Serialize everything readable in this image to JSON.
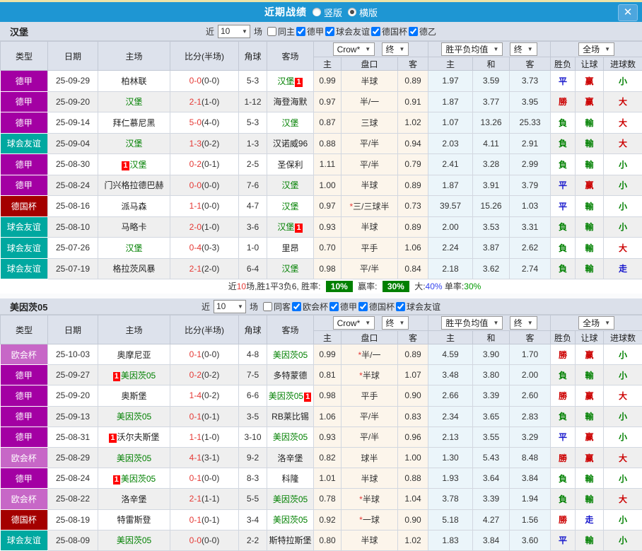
{
  "titlebar": {
    "title": "近期战绩",
    "radio_vertical": "竖版",
    "radio_horizontal": "横版",
    "close_glyph": "✕"
  },
  "colors": {
    "titlebar_bg": "#1E96D3",
    "top_strip": "#EDE3A8",
    "team_highlight": "#008000",
    "badge_red": "#FF0000",
    "score_red": "#E53935",
    "summary_badge_bg": "#008000",
    "type": {
      "德甲": "#A300A3",
      "球会友谊": "#00A8A0",
      "德国杯": "#A40000",
      "欧会杯": "#C767C7"
    },
    "result": {
      "勝": "#CC0000",
      "赢": "#CC0000",
      "大": "#CC0000",
      "負": "#008000",
      "輸": "#008000",
      "小": "#008000",
      "平": "#1515CC",
      "走": "#1515CC"
    }
  },
  "table_header": {
    "main_cols": [
      "类型",
      "日期",
      "主场",
      "比分(半场)",
      "角球",
      "客场"
    ],
    "sub_cols": [
      "主",
      "盘口",
      "客",
      "主",
      "和",
      "客",
      "胜负",
      "让球",
      "进球数"
    ],
    "dropdowns": {
      "bookmaker": "Crow*",
      "final1": "终",
      "avg": "胜平负均值",
      "final2": "终",
      "scope": "全场"
    }
  },
  "sections": [
    {
      "team": "汉堡",
      "filters": {
        "near_label": "近",
        "count": "10",
        "games_label": "场",
        "same_label": "同主",
        "same_checked": false,
        "leagues": [
          {
            "label": "德甲",
            "checked": true
          },
          {
            "label": "球会友谊",
            "checked": true
          },
          {
            "label": "德国杯",
            "checked": true
          },
          {
            "label": "德乙",
            "checked": true
          }
        ]
      },
      "rows": [
        {
          "type": "德甲",
          "date": "25-09-29",
          "home": "柏林联",
          "home_green": false,
          "home_badge": "",
          "score": "0-0",
          "half": "(0-0)",
          "corner": "5-3",
          "away": "汉堡",
          "away_green": true,
          "away_badge": "1",
          "odds": [
            "0.99",
            "半球",
            "0.89"
          ],
          "avg": [
            "1.97",
            "3.59",
            "3.73"
          ],
          "res": [
            "平",
            "赢",
            "小"
          ]
        },
        {
          "type": "德甲",
          "date": "25-09-20",
          "home": "汉堡",
          "home_green": true,
          "home_badge": "",
          "score": "2-1",
          "half": "(1-0)",
          "corner": "1-12",
          "away": "海登海默",
          "away_green": false,
          "away_badge": "",
          "odds": [
            "0.97",
            "半/一",
            "0.91"
          ],
          "avg": [
            "1.87",
            "3.77",
            "3.95"
          ],
          "res": [
            "勝",
            "赢",
            "大"
          ]
        },
        {
          "type": "德甲",
          "date": "25-09-14",
          "home": "拜仁慕尼黑",
          "home_green": false,
          "home_badge": "",
          "score": "5-0",
          "half": "(4-0)",
          "corner": "5-3",
          "away": "汉堡",
          "away_green": true,
          "away_badge": "",
          "odds": [
            "0.87",
            "三球",
            "1.02"
          ],
          "avg": [
            "1.07",
            "13.26",
            "25.33"
          ],
          "res": [
            "負",
            "輸",
            "大"
          ]
        },
        {
          "type": "球会友谊",
          "date": "25-09-04",
          "home": "汉堡",
          "home_green": true,
          "home_badge": "",
          "score": "1-3",
          "half": "(0-2)",
          "corner": "1-3",
          "away": "汉诺威96",
          "away_green": false,
          "away_badge": "",
          "odds": [
            "0.88",
            "平/半",
            "0.94"
          ],
          "avg": [
            "2.03",
            "4.11",
            "2.91"
          ],
          "res": [
            "負",
            "輸",
            "大"
          ]
        },
        {
          "type": "德甲",
          "date": "25-08-30",
          "home": "汉堡",
          "home_green": true,
          "home_badge": "1",
          "score": "0-2",
          "half": "(0-1)",
          "corner": "2-5",
          "away": "圣保利",
          "away_green": false,
          "away_badge": "",
          "odds": [
            "1.11",
            "平/半",
            "0.79"
          ],
          "avg": [
            "2.41",
            "3.28",
            "2.99"
          ],
          "res": [
            "負",
            "輸",
            "小"
          ]
        },
        {
          "type": "德甲",
          "date": "25-08-24",
          "home": "门兴格拉德巴赫",
          "home_green": false,
          "home_badge": "",
          "score": "0-0",
          "half": "(0-0)",
          "corner": "7-6",
          "away": "汉堡",
          "away_green": true,
          "away_badge": "",
          "odds": [
            "1.00",
            "半球",
            "0.89"
          ],
          "avg": [
            "1.87",
            "3.91",
            "3.79"
          ],
          "res": [
            "平",
            "赢",
            "小"
          ]
        },
        {
          "type": "德国杯",
          "date": "25-08-16",
          "home": "派马森",
          "home_green": false,
          "home_badge": "",
          "score": "1-1",
          "half": "(0-0)",
          "corner": "4-7",
          "away": "汉堡",
          "away_green": true,
          "away_badge": "",
          "odds": [
            "0.97",
            "*三/三球半",
            "0.73"
          ],
          "avg": [
            "39.57",
            "15.26",
            "1.03"
          ],
          "res": [
            "平",
            "輸",
            "小"
          ]
        },
        {
          "type": "球会友谊",
          "date": "25-08-10",
          "home": "马略卡",
          "home_green": false,
          "home_badge": "",
          "score": "2-0",
          "half": "(1-0)",
          "corner": "3-6",
          "away": "汉堡",
          "away_green": true,
          "away_badge": "1",
          "odds": [
            "0.93",
            "半球",
            "0.89"
          ],
          "avg": [
            "2.00",
            "3.53",
            "3.31"
          ],
          "res": [
            "負",
            "輸",
            "小"
          ]
        },
        {
          "type": "球会友谊",
          "date": "25-07-26",
          "home": "汉堡",
          "home_green": true,
          "home_badge": "",
          "score": "0-4",
          "half": "(0-3)",
          "corner": "1-0",
          "away": "里昂",
          "away_green": false,
          "away_badge": "",
          "odds": [
            "0.70",
            "平手",
            "1.06"
          ],
          "avg": [
            "2.24",
            "3.87",
            "2.62"
          ],
          "res": [
            "負",
            "輸",
            "大"
          ]
        },
        {
          "type": "球会友谊",
          "date": "25-07-19",
          "home": "格拉茨风暴",
          "home_green": false,
          "home_badge": "",
          "score": "2-1",
          "half": "(2-0)",
          "corner": "6-4",
          "away": "汉堡",
          "away_green": true,
          "away_badge": "",
          "odds": [
            "0.98",
            "平/半",
            "0.84"
          ],
          "avg": [
            "2.18",
            "3.62",
            "2.74"
          ],
          "res": [
            "負",
            "輸",
            "走"
          ]
        }
      ],
      "summary": {
        "pre": "近",
        "num": "10",
        "post": "场,胜1平3负6, 胜率:",
        "rate1": "10%",
        "label2": "赢率:",
        "rate2": "30%",
        "label3": "大:",
        "rate3": "40%",
        "label4": "单率:",
        "rate4": "30%"
      }
    },
    {
      "team": "美因茨05",
      "filters": {
        "near_label": "近",
        "count": "10",
        "games_label": "场",
        "same_label": "同客",
        "same_checked": false,
        "leagues": [
          {
            "label": "欧会杯",
            "checked": true
          },
          {
            "label": "德甲",
            "checked": true
          },
          {
            "label": "德国杯",
            "checked": true
          },
          {
            "label": "球会友谊",
            "checked": true
          }
        ]
      },
      "rows": [
        {
          "type": "欧会杯",
          "date": "25-10-03",
          "home": "奥摩尼亚",
          "home_green": false,
          "home_badge": "",
          "score": "0-1",
          "half": "(0-0)",
          "corner": "4-8",
          "away": "美因茨05",
          "away_green": true,
          "away_badge": "",
          "odds": [
            "0.99",
            "*半/一",
            "0.89"
          ],
          "avg": [
            "4.59",
            "3.90",
            "1.70"
          ],
          "res": [
            "勝",
            "赢",
            "小"
          ]
        },
        {
          "type": "德甲",
          "date": "25-09-27",
          "home": "美因茨05",
          "home_green": true,
          "home_badge": "1",
          "score": "0-2",
          "half": "(0-2)",
          "corner": "7-5",
          "away": "多特蒙德",
          "away_green": false,
          "away_badge": "",
          "odds": [
            "0.81",
            "*半球",
            "1.07"
          ],
          "avg": [
            "3.48",
            "3.80",
            "2.00"
          ],
          "res": [
            "負",
            "輸",
            "小"
          ]
        },
        {
          "type": "德甲",
          "date": "25-09-20",
          "home": "奥斯堡",
          "home_green": false,
          "home_badge": "",
          "score": "1-4",
          "half": "(0-2)",
          "corner": "6-6",
          "away": "美因茨05",
          "away_green": true,
          "away_badge": "1",
          "odds": [
            "0.98",
            "平手",
            "0.90"
          ],
          "avg": [
            "2.66",
            "3.39",
            "2.60"
          ],
          "res": [
            "勝",
            "赢",
            "大"
          ]
        },
        {
          "type": "德甲",
          "date": "25-09-13",
          "home": "美因茨05",
          "home_green": true,
          "home_badge": "",
          "score": "0-1",
          "half": "(0-1)",
          "corner": "3-5",
          "away": "RB莱比锡",
          "away_green": false,
          "away_badge": "",
          "odds": [
            "1.06",
            "平/半",
            "0.83"
          ],
          "avg": [
            "2.34",
            "3.65",
            "2.83"
          ],
          "res": [
            "負",
            "輸",
            "小"
          ]
        },
        {
          "type": "德甲",
          "date": "25-08-31",
          "home": "沃尔夫斯堡",
          "home_green": false,
          "home_badge": "1",
          "score": "1-1",
          "half": "(1-0)",
          "corner": "3-10",
          "away": "美因茨05",
          "away_green": true,
          "away_badge": "",
          "odds": [
            "0.93",
            "平/半",
            "0.96"
          ],
          "avg": [
            "2.13",
            "3.55",
            "3.29"
          ],
          "res": [
            "平",
            "赢",
            "小"
          ]
        },
        {
          "type": "欧会杯",
          "date": "25-08-29",
          "home": "美因茨05",
          "home_green": true,
          "home_badge": "",
          "score": "4-1",
          "half": "(3-1)",
          "corner": "9-2",
          "away": "洛辛堡",
          "away_green": false,
          "away_badge": "",
          "odds": [
            "0.82",
            "球半",
            "1.00"
          ],
          "avg": [
            "1.30",
            "5.43",
            "8.48"
          ],
          "res": [
            "勝",
            "赢",
            "大"
          ]
        },
        {
          "type": "德甲",
          "date": "25-08-24",
          "home": "美因茨05",
          "home_green": true,
          "home_badge": "1",
          "score": "0-1",
          "half": "(0-0)",
          "corner": "8-3",
          "away": "科隆",
          "away_green": false,
          "away_badge": "",
          "odds": [
            "1.01",
            "半球",
            "0.88"
          ],
          "avg": [
            "1.93",
            "3.64",
            "3.84"
          ],
          "res": [
            "負",
            "輸",
            "小"
          ]
        },
        {
          "type": "欧会杯",
          "date": "25-08-22",
          "home": "洛辛堡",
          "home_green": false,
          "home_badge": "",
          "score": "2-1",
          "half": "(1-1)",
          "corner": "5-5",
          "away": "美因茨05",
          "away_green": true,
          "away_badge": "",
          "odds": [
            "0.78",
            "*半球",
            "1.04"
          ],
          "avg": [
            "3.78",
            "3.39",
            "1.94"
          ],
          "res": [
            "負",
            "輸",
            "大"
          ]
        },
        {
          "type": "德国杯",
          "date": "25-08-19",
          "home": "特雷斯登",
          "home_green": false,
          "home_badge": "",
          "score": "0-1",
          "half": "(0-1)",
          "corner": "3-4",
          "away": "美因茨05",
          "away_green": true,
          "away_badge": "",
          "odds": [
            "0.92",
            "*一球",
            "0.90"
          ],
          "avg": [
            "5.18",
            "4.27",
            "1.56"
          ],
          "res": [
            "勝",
            "走",
            "小"
          ]
        },
        {
          "type": "球会友谊",
          "date": "25-08-09",
          "home": "美因茨05",
          "home_green": true,
          "home_badge": "",
          "score": "0-0",
          "half": "(0-0)",
          "corner": "2-2",
          "away": "斯特拉斯堡",
          "away_green": false,
          "away_badge": "",
          "odds": [
            "0.80",
            "半球",
            "1.02"
          ],
          "avg": [
            "1.83",
            "3.84",
            "3.60"
          ],
          "res": [
            "平",
            "輸",
            "小"
          ]
        }
      ]
    }
  ]
}
